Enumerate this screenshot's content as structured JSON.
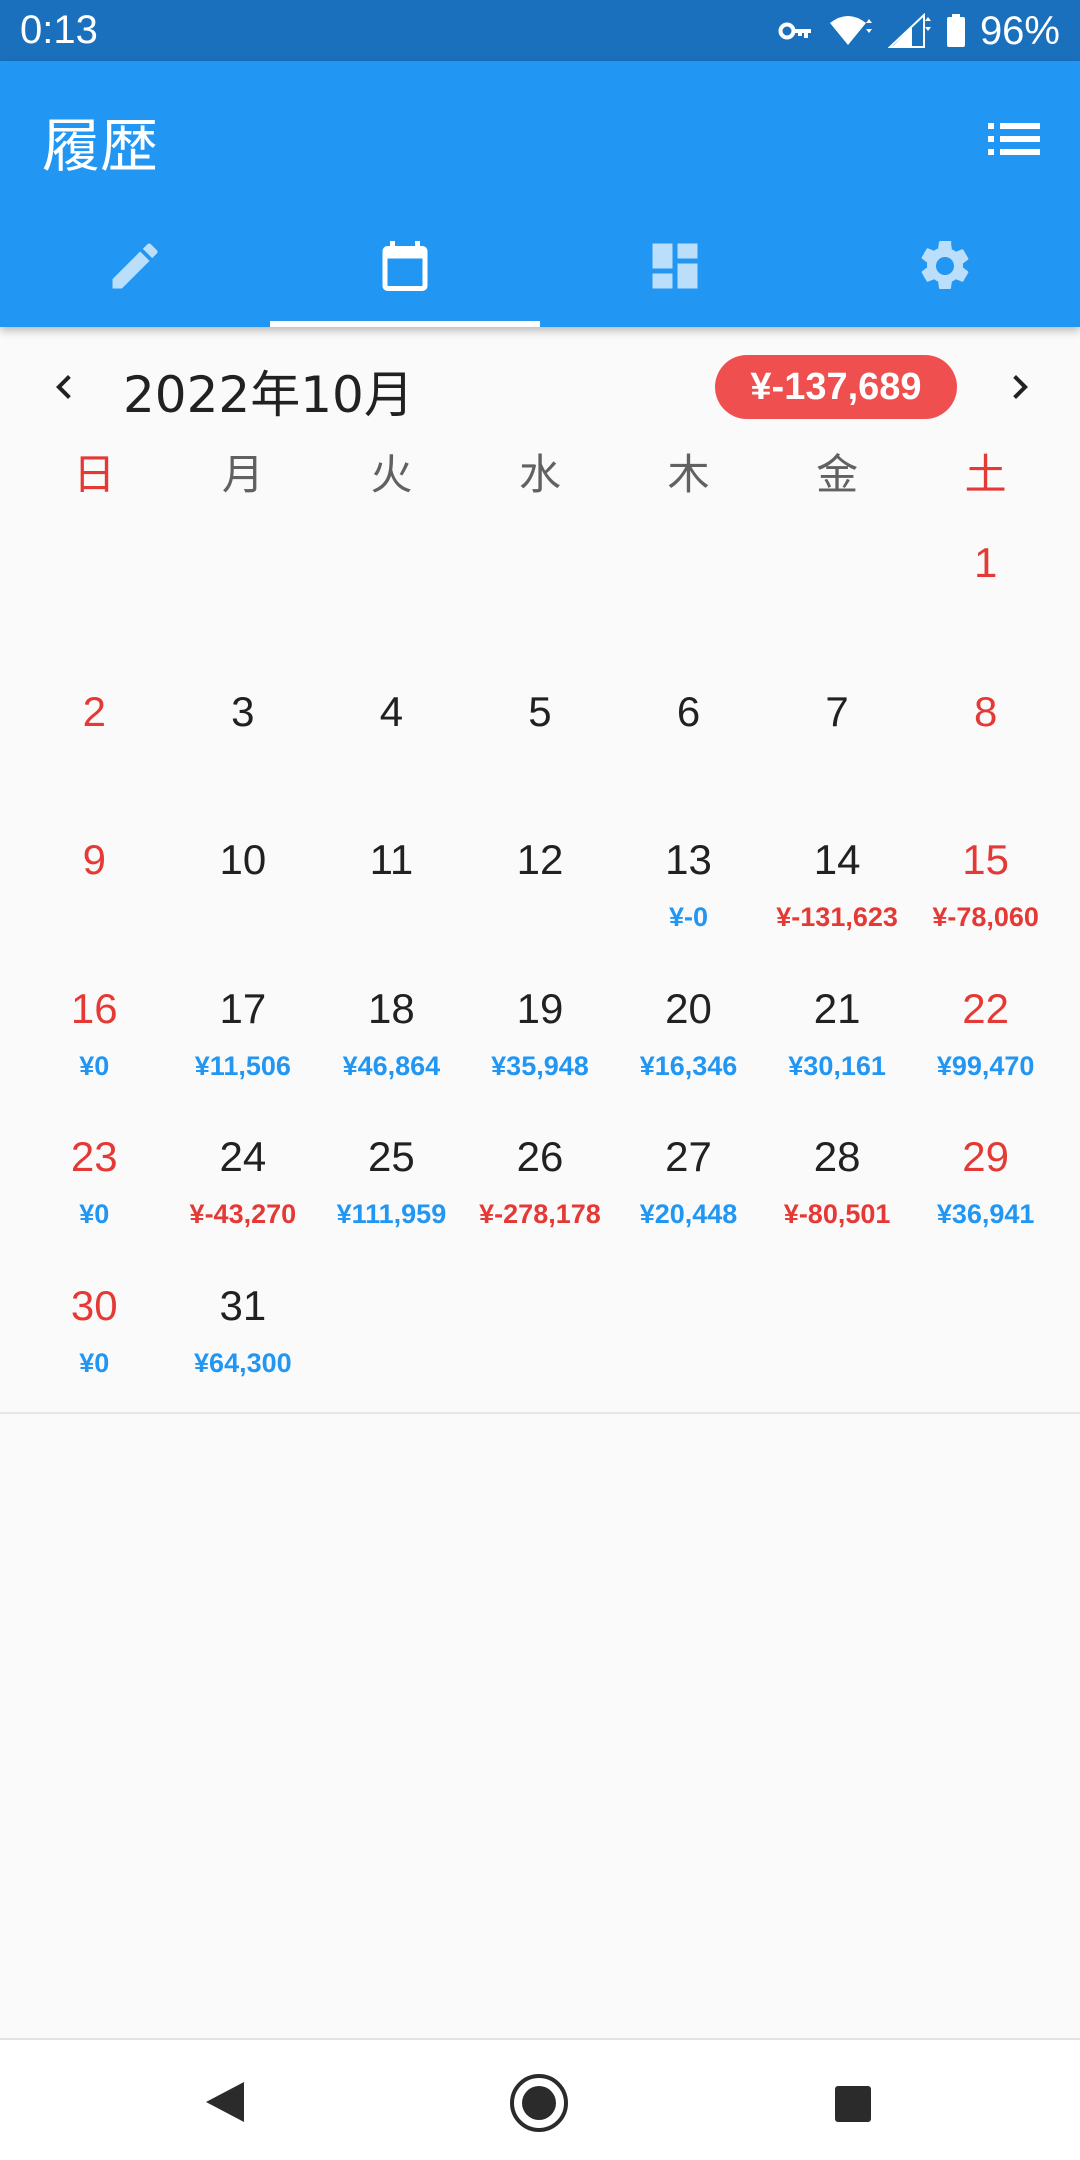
{
  "status_bar": {
    "time": "0:13",
    "battery": "96%"
  },
  "app_bar": {
    "title": "履歴",
    "tabs": [
      {
        "icon": "pencil-icon",
        "selected": false
      },
      {
        "icon": "calendar-icon",
        "selected": true
      },
      {
        "icon": "dashboard-icon",
        "selected": false
      },
      {
        "icon": "gear-icon",
        "selected": false
      }
    ]
  },
  "calendar": {
    "month_title": "2022年10月",
    "month_total": "¥-137,689",
    "weekdays": [
      "日",
      "月",
      "火",
      "水",
      "木",
      "金",
      "土"
    ],
    "weeks": [
      {
        "days": [
          {
            "day": "",
            "amount": ""
          },
          {
            "day": "",
            "amount": ""
          },
          {
            "day": "",
            "amount": ""
          },
          {
            "day": "",
            "amount": ""
          },
          {
            "day": "",
            "amount": ""
          },
          {
            "day": "",
            "amount": ""
          },
          {
            "day": "1",
            "amount": ""
          }
        ]
      },
      {
        "days": [
          {
            "day": "2",
            "amount": ""
          },
          {
            "day": "3",
            "amount": ""
          },
          {
            "day": "4",
            "amount": ""
          },
          {
            "day": "5",
            "amount": ""
          },
          {
            "day": "6",
            "amount": ""
          },
          {
            "day": "7",
            "amount": ""
          },
          {
            "day": "8",
            "amount": ""
          }
        ]
      },
      {
        "days": [
          {
            "day": "9",
            "amount": ""
          },
          {
            "day": "10",
            "amount": ""
          },
          {
            "day": "11",
            "amount": ""
          },
          {
            "day": "12",
            "amount": ""
          },
          {
            "day": "13",
            "amount": "¥-0"
          },
          {
            "day": "14",
            "amount": "¥-131,623"
          },
          {
            "day": "15",
            "amount": "¥-78,060"
          }
        ]
      },
      {
        "days": [
          {
            "day": "16",
            "amount": "¥0"
          },
          {
            "day": "17",
            "amount": "¥11,506"
          },
          {
            "day": "18",
            "amount": "¥46,864"
          },
          {
            "day": "19",
            "amount": "¥35,948"
          },
          {
            "day": "20",
            "amount": "¥16,346"
          },
          {
            "day": "21",
            "amount": "¥30,161"
          },
          {
            "day": "22",
            "amount": "¥99,470"
          }
        ]
      },
      {
        "days": [
          {
            "day": "23",
            "amount": "¥0"
          },
          {
            "day": "24",
            "amount": "¥-43,270"
          },
          {
            "day": "25",
            "amount": "¥111,959"
          },
          {
            "day": "26",
            "amount": "¥-278,178"
          },
          {
            "day": "27",
            "amount": "¥20,448"
          },
          {
            "day": "28",
            "amount": "¥-80,501"
          },
          {
            "day": "29",
            "amount": "¥36,941"
          }
        ]
      },
      {
        "days": [
          {
            "day": "30",
            "amount": "¥0"
          },
          {
            "day": "31",
            "amount": "¥64,300"
          },
          {
            "day": "",
            "amount": ""
          },
          {
            "day": "",
            "amount": ""
          },
          {
            "day": "",
            "amount": ""
          },
          {
            "day": "",
            "amount": ""
          },
          {
            "day": "",
            "amount": ""
          }
        ]
      }
    ]
  },
  "colors": {
    "app_bar": "#2196f3",
    "status_bar": "#1a70bd",
    "positive": "#2196f3",
    "negative": "#e53935",
    "total_pill": "#ef4f4f"
  }
}
